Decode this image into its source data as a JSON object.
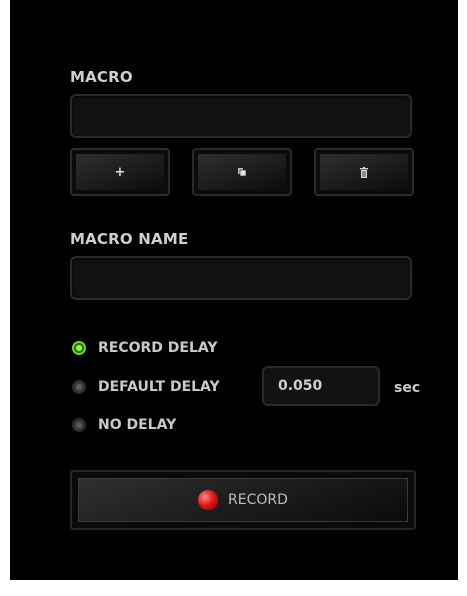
{
  "macro": {
    "label": "MACRO",
    "value": ""
  },
  "actions": {
    "add": {
      "icon": "plus-icon",
      "glyph": "+"
    },
    "copy": {
      "icon": "copy-icon"
    },
    "delete": {
      "icon": "trash-icon"
    }
  },
  "macro_name": {
    "label": "MACRO NAME",
    "value": ""
  },
  "delay_options": [
    {
      "label": "RECORD DELAY",
      "selected": true
    },
    {
      "label": "DEFAULT DELAY",
      "selected": false
    },
    {
      "label": "NO DELAY",
      "selected": false
    }
  ],
  "default_delay": {
    "value": "0.050",
    "unit": "sec"
  },
  "record": {
    "label": "RECORD",
    "icon": "record-dot-icon"
  },
  "colors": {
    "accent_green": "#8fff3a",
    "record_red": "#e01818",
    "panel_bg": "#000000"
  }
}
